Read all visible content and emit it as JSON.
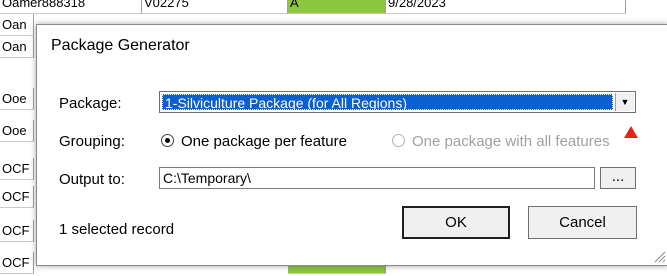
{
  "background": {
    "top_row": {
      "name": "Oamer888318",
      "code": "V02275",
      "flag": "A",
      "date": "9/28/2023"
    },
    "row_prefixes": [
      "Oan",
      "Oan",
      "Ooe",
      "Ooe",
      "OCF",
      "OCF",
      "OCF",
      "OCF"
    ],
    "accent_green": "#8cc63f"
  },
  "dialog": {
    "title": "Package Generator",
    "package_label": "Package:",
    "package_value": "1-Silviculture Package (for All Regions)",
    "grouping_label": "Grouping:",
    "grouping_options": [
      {
        "label": "One package per feature",
        "selected": true,
        "enabled": true
      },
      {
        "label": "One package with all features",
        "selected": false,
        "enabled": false
      }
    ],
    "output_label": "Output to:",
    "output_value": "C:\\Temporary\\",
    "browse_label": "...",
    "status": "1 selected record",
    "ok_label": "OK",
    "cancel_label": "Cancel",
    "selection_color": "#0a5fd1",
    "warning_color": "#e2231a"
  }
}
